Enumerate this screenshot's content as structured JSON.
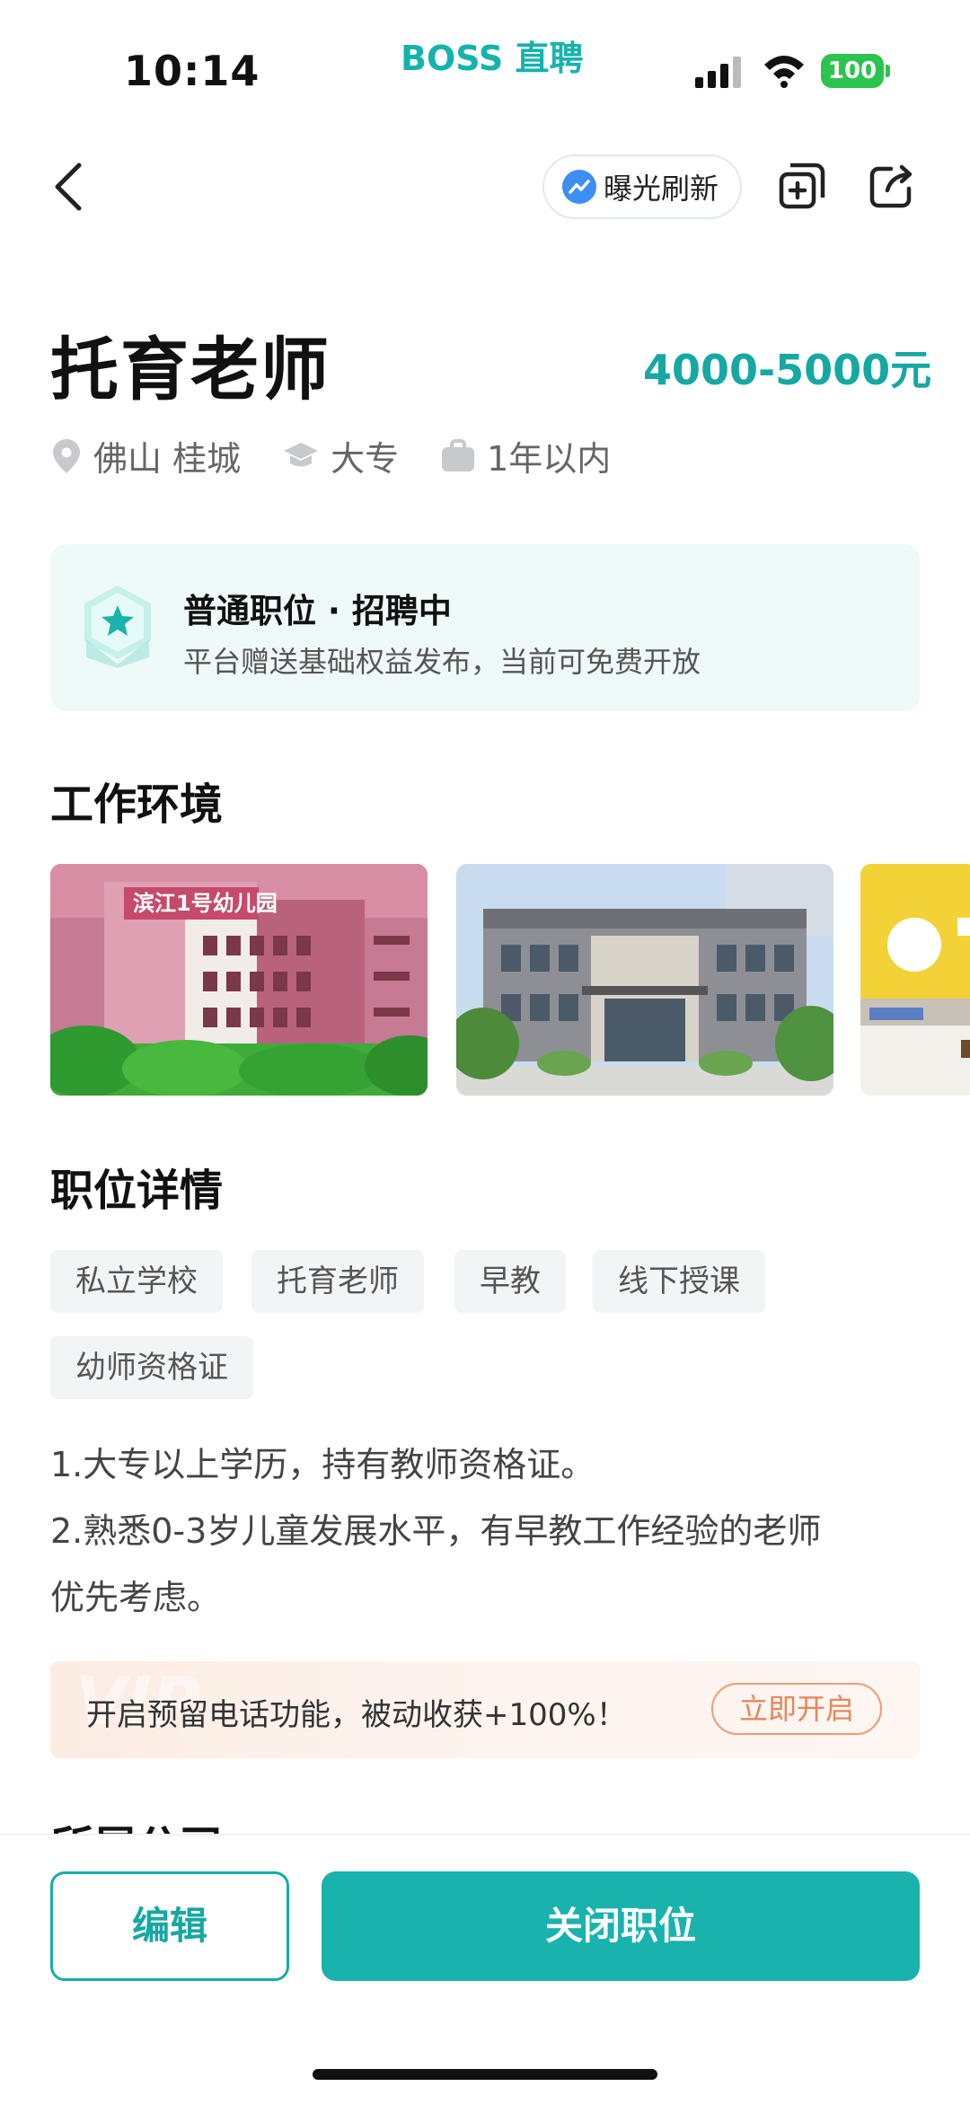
{
  "status_bar": {
    "time": "10:14",
    "brand": "BOSS 直聘",
    "battery": "100"
  },
  "nav": {
    "refresh_label": "曝光刷新"
  },
  "job": {
    "title": "托育老师",
    "salary": "4000-5000元",
    "location": "佛山 桂城",
    "education": "大专",
    "experience": "1年以内"
  },
  "status_card": {
    "title": "普通职位 · 招聘中",
    "subtitle": "平台赠送基础权益发布，当前可免费开放"
  },
  "environment": {
    "title": "工作环境",
    "photo1_sign": "滨江1号幼儿园"
  },
  "details": {
    "title": "职位详情",
    "tags": [
      "私立学校",
      "托育老师",
      "早教",
      "线下授课",
      "幼师资格证"
    ],
    "lines": [
      "1.大专以上学历，持有教师资格证。",
      "2.熟悉0-3岁儿童发展水平，有早教工作经验的老师",
      "优先考虑。"
    ]
  },
  "vip_banner": {
    "text": "开启预留电话功能，被动收获+100%！",
    "button": "立即开启",
    "watermark": "VIP"
  },
  "company": {
    "title": "所属公司"
  },
  "actions": {
    "edit": "编辑",
    "close": "关闭职位"
  },
  "colors": {
    "accent": "#19b2ad",
    "salary": "#16a8a3",
    "vip_button": "#e8855a"
  }
}
